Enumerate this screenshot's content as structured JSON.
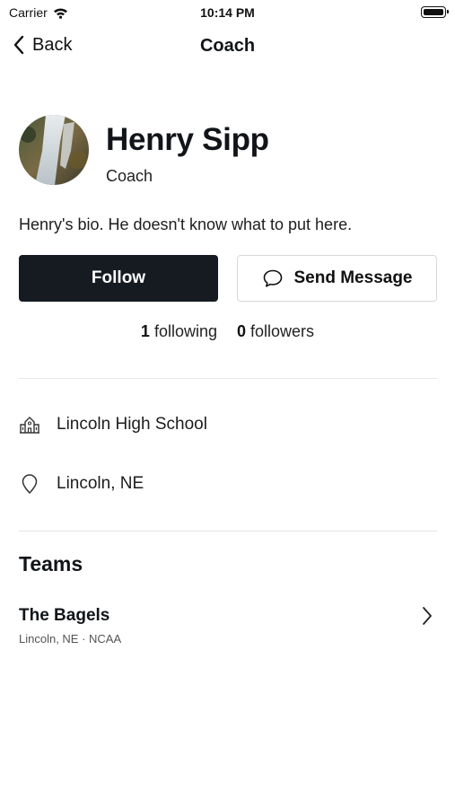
{
  "status_bar": {
    "carrier": "Carrier",
    "time": "10:14 PM"
  },
  "nav": {
    "back_label": "Back",
    "title": "Coach"
  },
  "profile": {
    "name": "Henry Sipp",
    "role": "Coach",
    "bio": "Henry's bio. He doesn't know what to put here.",
    "follow_label": "Follow",
    "message_label": "Send Message",
    "following_count": "1",
    "following_label": "following",
    "followers_count": "0",
    "followers_label": "followers"
  },
  "details": {
    "school": "Lincoln High School",
    "location": "Lincoln, NE",
    "school_icon": "school-building-icon",
    "location_icon": "map-pin-icon"
  },
  "teams": {
    "title": "Teams",
    "items": [
      {
        "name": "The Bagels",
        "meta": "Lincoln, NE · NCAA"
      }
    ]
  },
  "colors": {
    "primary_button": "#161b22",
    "divider": "#e3e5e8",
    "text": "#111418"
  }
}
